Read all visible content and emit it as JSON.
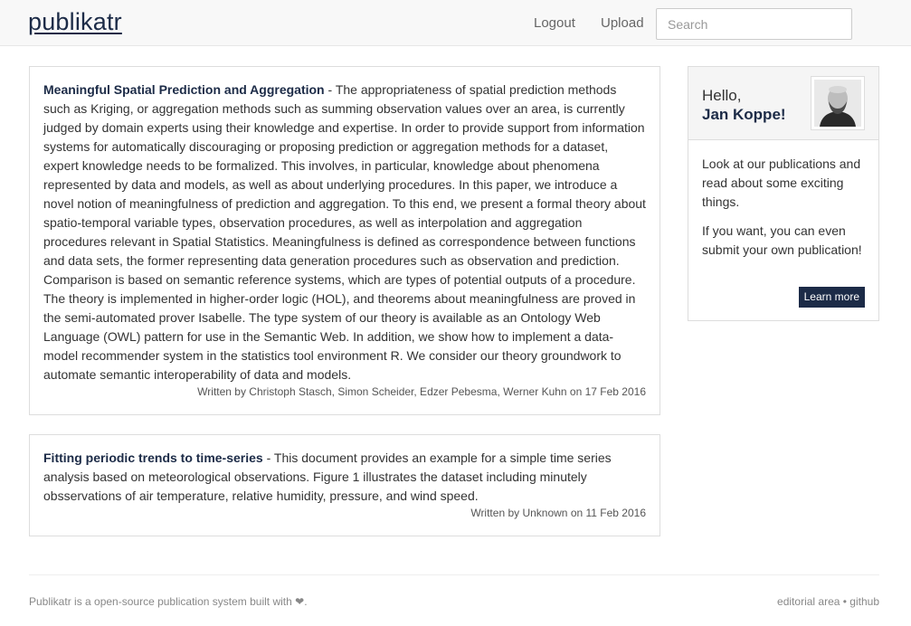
{
  "header": {
    "brand": "publikatr",
    "nav": {
      "logout": "Logout",
      "upload": "Upload"
    },
    "search": {
      "placeholder": "Search",
      "value": ""
    }
  },
  "publications": [
    {
      "title": "Meaningful Spatial Prediction and Aggregation",
      "separator": " - ",
      "abstract": "The appropriateness of spatial prediction methods such as Kriging, or aggregation methods such as summing observation values over an area, is currently judged by domain experts using their knowledge and expertise. In order to provide support from information systems for automatically discouraging or proposing prediction or aggregation methods for a dataset, expert knowledge needs to be formalized. This involves, in particular, knowledge about phenomena represented by data and models, as well as about underlying procedures. In this paper, we introduce a novel notion of meaningfulness of prediction and aggregation. To this end, we present a formal theory about spatio-temporal variable types, observation procedures, as well as interpolation and aggregation procedures relevant in Spatial Statistics. Meaningfulness is defined as correspondence between functions and data sets, the former representing data generation procedures such as observation and prediction. Comparison is based on semantic reference systems, which are types of potential outputs of a procedure. The theory is implemented in higher-order logic (HOL), and theorems about meaningfulness are proved in the semi-automated prover Isabelle. The type system of our theory is available as an Ontology Web Language (OWL) pattern for use in the Semantic Web. In addition, we show how to implement a data-model recommender system in the statistics tool environment R. We consider our theory groundwork to automate semantic interoperability of data and models.",
      "byline": "Written by Christoph Stasch, Simon Scheider, Edzer Pebesma, Werner Kuhn on 17 Feb 2016"
    },
    {
      "title": "Fitting periodic trends to time-series",
      "separator": " - ",
      "abstract": "This document provides an example for a simple time series analysis based on meteorological observations. Figure 1 illustrates the dataset including minutely obsservations of air temperature, relative humidity, pressure, and wind speed.",
      "byline": "Written by Unknown on 11 Feb 2016"
    }
  ],
  "sidebar": {
    "greeting": "Hello,",
    "user_name": "Jan Koppe!",
    "avatar_icon": "user-avatar-photo",
    "paragraph1": "Look at our publications and read about some exciting things.",
    "paragraph2": "If you want, you can even submit your own publication!",
    "learn_more": "Learn more"
  },
  "footer": {
    "left": "Publikatr is a open-source publication system built with ❤.",
    "editorial": "editorial area",
    "bullet": " • ",
    "github": "github"
  },
  "colors": {
    "brand": "#1c2b47",
    "navbar_bg": "#f8f8f8",
    "muted": "#888888"
  }
}
